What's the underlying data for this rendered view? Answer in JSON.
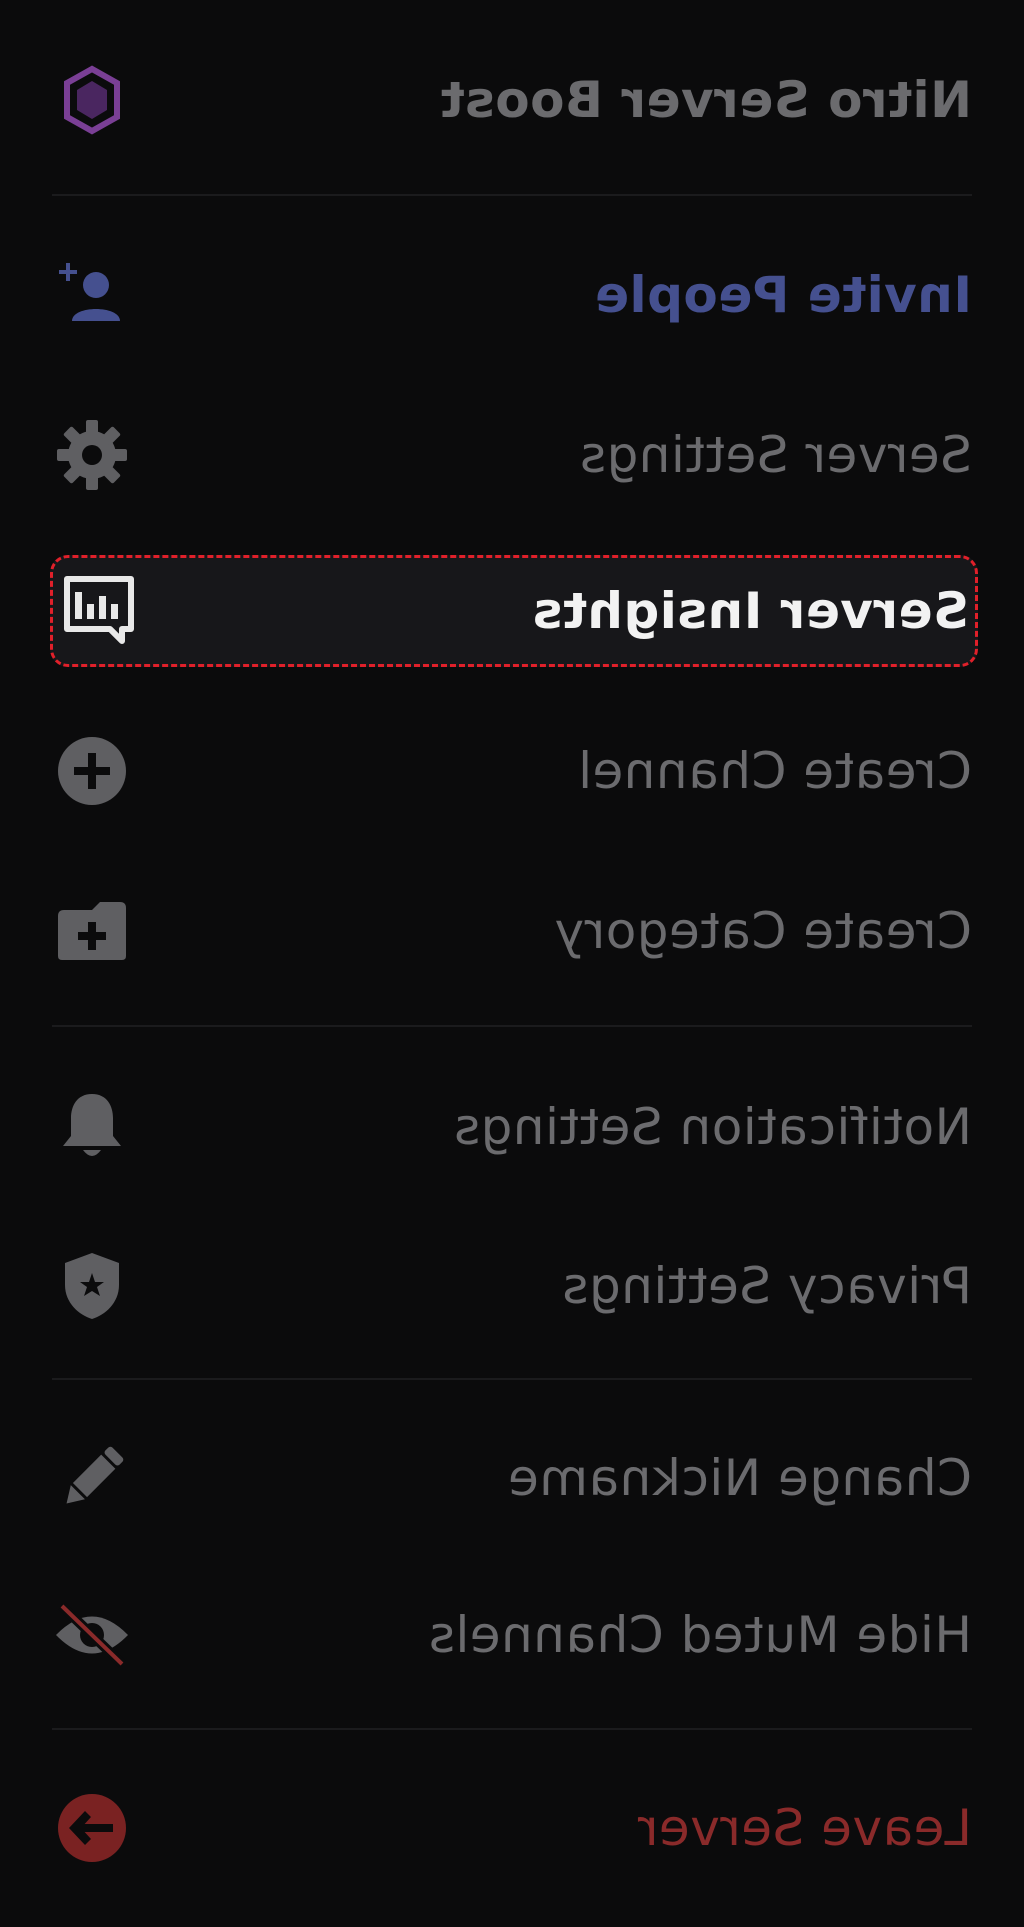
{
  "menu": {
    "nitro_boost": "Nitro Server Boost",
    "invite_people": "Invite People",
    "server_settings": "Server Settings",
    "server_insights": "Server Insights",
    "create_channel": "Create Channel",
    "create_category": "Create Category",
    "notification_settings": "Notification Settings",
    "privacy_settings": "Privacy Settings",
    "change_nickname": "Change Nickname",
    "hide_muted_channels": "Hide Muted Channels",
    "leave_server": "Leave Server"
  },
  "colors": {
    "background": "#0b0b0c",
    "muted_text": "#6b6b6e",
    "accent_blue": "#45508f",
    "danger_red": "#8a2a2a",
    "nitro_purple": "#7a3f95",
    "highlight_border": "#e0202a"
  },
  "icons": {
    "nitro_boost": "boost-gem-icon",
    "invite_people": "add-user-icon",
    "server_settings": "gear-icon",
    "server_insights": "insights-chart-icon",
    "create_channel": "plus-circle-icon",
    "create_category": "folder-plus-icon",
    "notification_settings": "bell-icon",
    "privacy_settings": "shield-star-icon",
    "change_nickname": "pencil-icon",
    "hide_muted_channels": "eye-slash-icon",
    "leave_server": "leave-arrow-icon"
  }
}
